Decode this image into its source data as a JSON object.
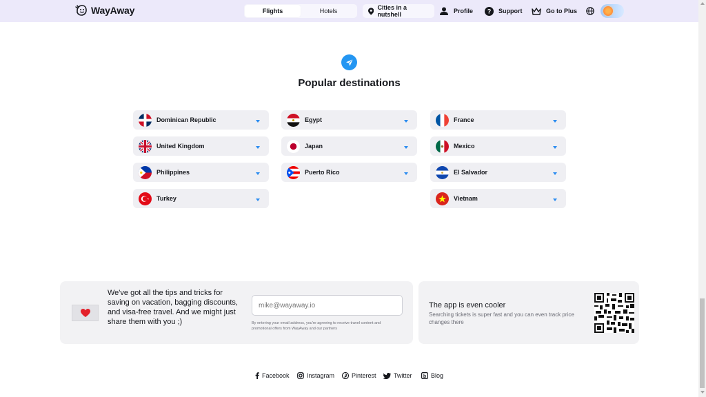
{
  "header": {
    "logo_text": "WayAway",
    "tabs": [
      {
        "label": "Flights",
        "active": true
      },
      {
        "label": "Hotels",
        "active": false
      }
    ],
    "nav": {
      "cities": "Cities in a nutshell",
      "profile": "Profile",
      "support": "Support",
      "plus": "Go to Plus"
    },
    "icons": [
      "pin-icon",
      "profile-icon",
      "support-icon",
      "crown-icon",
      "globe-icon"
    ]
  },
  "section": {
    "title": "Popular destinations",
    "icon": "send-icon",
    "accent": "#2496f2"
  },
  "destinations": [
    {
      "label": "Dominican Republic",
      "flag": "dominican-republic"
    },
    {
      "label": "Egypt",
      "flag": "egypt"
    },
    {
      "label": "France",
      "flag": "france"
    },
    {
      "label": "United Kingdom",
      "flag": "united-kingdom"
    },
    {
      "label": "Japan",
      "flag": "japan"
    },
    {
      "label": "Mexico",
      "flag": "mexico"
    },
    {
      "label": "Philippines",
      "flag": "philippines"
    },
    {
      "label": "Puerto Rico",
      "flag": "puerto-rico"
    },
    {
      "label": "El Salvador",
      "flag": "el-salvador"
    },
    {
      "label": "Turkey",
      "flag": "turkey"
    },
    {
      "label": "Vietnam",
      "flag": "vietnam"
    }
  ],
  "newsletter": {
    "text": "We've got all the tips and tricks for saving on vacation, bagging discounts, and visa-free travel. And we might just share them with you ;)",
    "email_placeholder": "mike@wayaway.io",
    "disclaimer": "By entering your email address, you're agreeing to receive travel content and promotional offers from WayAway and our partners"
  },
  "app_promo": {
    "title": "The app is even cooler",
    "subtitle": "Searching tickets is super fast and you can even track price changes there"
  },
  "footer": {
    "links": [
      {
        "label": "Facebook",
        "icon": "facebook-icon"
      },
      {
        "label": "Instagram",
        "icon": "instagram-icon"
      },
      {
        "label": "Pinterest",
        "icon": "pinterest-icon"
      },
      {
        "label": "Twitter",
        "icon": "twitter-icon"
      },
      {
        "label": "Blog",
        "icon": "blog-icon"
      }
    ]
  }
}
